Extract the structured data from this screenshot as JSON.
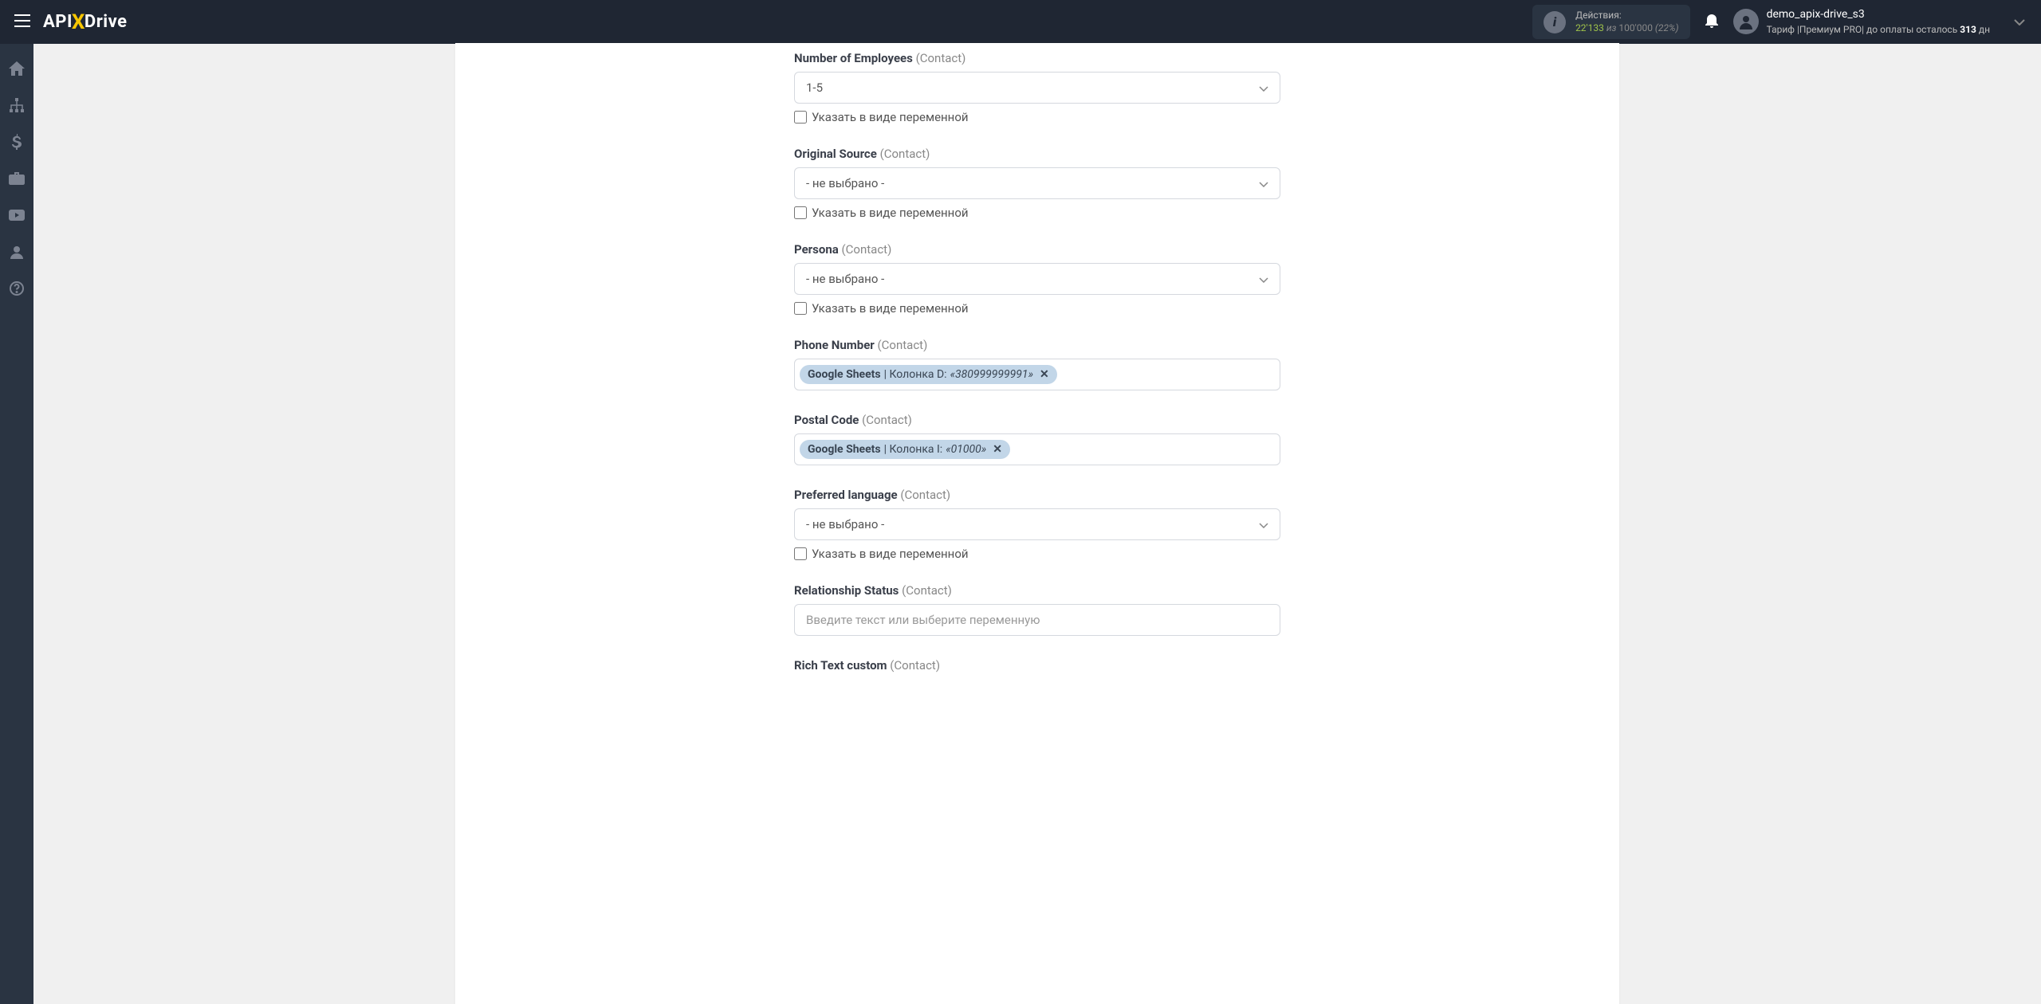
{
  "header": {
    "logo_pre": "API",
    "logo_x": "X",
    "logo_post": "Drive",
    "actions_label": "Действия:",
    "actions_used": "22'133",
    "actions_of": " из ",
    "actions_total": "100'000",
    "actions_pct": " (22%)",
    "user_name": "demo_apix-drive_s3",
    "tariff_pre": "Тариф |Премиум PRO| до оплаты осталось ",
    "tariff_days": "313",
    "tariff_post": " дн"
  },
  "checkbox_label": "Указать в виде переменной",
  "not_selected": "- не выбрано -",
  "input_placeholder": "Введите текст или выберите переменную",
  "fields": {
    "employees": {
      "label": "Number of Employees",
      "context": "(Contact)",
      "value": "1-5"
    },
    "original_source": {
      "label": "Original Source",
      "context": "(Contact)"
    },
    "persona": {
      "label": "Persona",
      "context": "(Contact)"
    },
    "phone": {
      "label": "Phone Number",
      "context": "(Contact)",
      "chip_source": "Google Sheets",
      "chip_col": " | Колонка D: ",
      "chip_val": "«380999999991»"
    },
    "postal": {
      "label": "Postal Code",
      "context": "(Contact)",
      "chip_source": "Google Sheets",
      "chip_col": " | Колонка I: ",
      "chip_val": "«01000»"
    },
    "language": {
      "label": "Preferred language",
      "context": "(Contact)"
    },
    "relationship": {
      "label": "Relationship Status",
      "context": "(Contact)"
    },
    "rich_text": {
      "label": "Rich Text custom",
      "context": "(Contact)"
    }
  }
}
